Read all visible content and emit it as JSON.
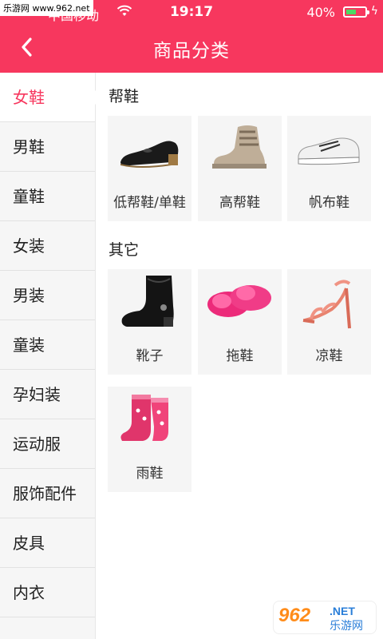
{
  "status_bar": {
    "carrier": "中国移动",
    "time": "19:17",
    "battery": "40%"
  },
  "watermark": {
    "top": "乐游网 www.962.net",
    "bottom_num": "962",
    "bottom_net": ".NET",
    "bottom_cn": "乐游网"
  },
  "nav": {
    "title": "商品分类",
    "back_icon": "chevron-left-icon"
  },
  "sidebar": {
    "items": [
      {
        "label": "女鞋",
        "active": true
      },
      {
        "label": "男鞋"
      },
      {
        "label": "童鞋"
      },
      {
        "label": "女装"
      },
      {
        "label": "男装"
      },
      {
        "label": "童装"
      },
      {
        "label": "孕妇装"
      },
      {
        "label": "运动服"
      },
      {
        "label": "服饰配件"
      },
      {
        "label": "皮具"
      },
      {
        "label": "内衣"
      }
    ]
  },
  "sections": [
    {
      "title": "帮鞋",
      "items": [
        {
          "label": "低帮鞋/单鞋",
          "icon": "flat-shoe-icon"
        },
        {
          "label": "高帮鞋",
          "icon": "high-top-sneaker-icon"
        },
        {
          "label": "帆布鞋",
          "icon": "canvas-shoe-icon"
        }
      ]
    },
    {
      "title": "其它",
      "items": [
        {
          "label": "靴子",
          "icon": "boot-icon"
        },
        {
          "label": "拖鞋",
          "icon": "slipper-icon"
        },
        {
          "label": "凉鞋",
          "icon": "sandal-icon"
        },
        {
          "label": "雨鞋",
          "icon": "rain-boot-icon"
        }
      ]
    }
  ],
  "colors": {
    "accent": "#f7375e"
  }
}
